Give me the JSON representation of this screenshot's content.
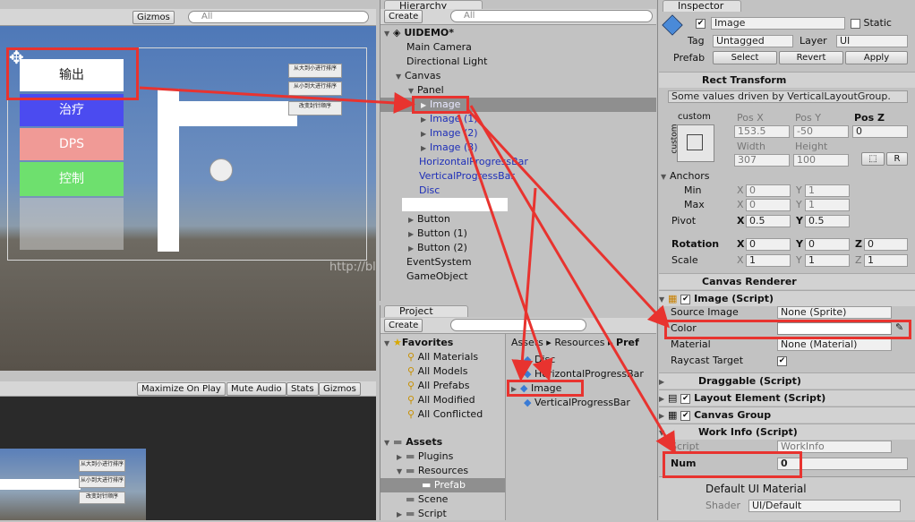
{
  "scene_toolbar": {
    "gizmos": "Gizmos",
    "search_placeholder": "All"
  },
  "scene": {
    "btn_output": "输出",
    "btn_heal": "治疗",
    "btn_dps": "DPS",
    "btn_control": "控制",
    "ctx1": "从大到小进行排序",
    "ctx2": "从小到大进行排序",
    "ctx3": "改变封针顺序",
    "watermark": "http://blog.csdn.net/"
  },
  "game_toolbar": {
    "maximize": "Maximize On Play",
    "mute": "Mute Audio",
    "stats": "Stats",
    "gizmos": "Gizmos"
  },
  "game": {
    "ctx1": "从大到小进行排序",
    "ctx2": "从小到大进行排序",
    "ctx3": "改变封针顺序"
  },
  "hierarchy": {
    "tab": "Hierarchy",
    "create": "Create",
    "search_placeholder": "All",
    "scene_name": "UIDEMO*",
    "items": [
      "Main Camera",
      "Directional Light",
      "Canvas",
      "Panel",
      "Image",
      "Image (1)",
      "Image (2)",
      "Image (3)",
      "HorizontalProgressBar",
      "VerticalProgressBar",
      "Disc",
      "Button",
      "Button (1)",
      "Button (2)",
      "EventSystem",
      "GameObject"
    ]
  },
  "project": {
    "tab": "Project",
    "create": "Create",
    "favorites": "Favorites",
    "fav_items": [
      "All Materials",
      "All Models",
      "All Prefabs",
      "All Modified",
      "All Conflicted"
    ],
    "assets": "Assets",
    "asset_items": [
      "Plugins",
      "Resources",
      "Prefab",
      "Scene",
      "Script"
    ],
    "breadcrumb": [
      "Assets",
      "Resources",
      "Pref"
    ],
    "files": [
      "Disc",
      "HorizontalProgressBar",
      "Image",
      "VerticalProgressBar"
    ]
  },
  "inspector": {
    "tab": "Inspector",
    "name": "Image",
    "static": "Static",
    "tag_label": "Tag",
    "tag": "Untagged",
    "layer_label": "Layer",
    "layer": "UI",
    "prefab_label": "Prefab",
    "select": "Select",
    "revert": "Revert",
    "apply": "Apply",
    "rect_transform": "Rect Transform",
    "driven_note": "Some values driven by VerticalLayoutGroup.",
    "anchor_preset": "custom",
    "anchor_side": "custom",
    "pos_x_label": "Pos X",
    "pos_y_label": "Pos Y",
    "pos_z_label": "Pos Z",
    "pos_x": "153.5",
    "pos_y": "-50",
    "pos_z": "0",
    "width_label": "Width",
    "height_label": "Height",
    "width": "307",
    "height": "100",
    "r_button": "R",
    "anchors": "Anchors",
    "min": "Min",
    "max": "Max",
    "pivot": "Pivot",
    "x": "X",
    "y": "Y",
    "z": "Z",
    "min_x": "0",
    "min_y": "1",
    "max_x": "0",
    "max_y": "1",
    "pivot_x": "0.5",
    "pivot_y": "0.5",
    "rotation": "Rotation",
    "rot_x": "0",
    "rot_y": "0",
    "rot_z": "0",
    "scale": "Scale",
    "scale_x": "1",
    "scale_y": "1",
    "scale_z": "1",
    "canvas_renderer": "Canvas Renderer",
    "image_script": "Image (Script)",
    "source_image": "Source Image",
    "source_image_val": "None (Sprite)",
    "color": "Color",
    "material": "Material",
    "material_val": "None (Material)",
    "raycast": "Raycast Target",
    "draggable": "Draggable (Script)",
    "layout_element": "Layout Element (Script)",
    "canvas_group": "Canvas Group",
    "work_info": "Work Info (Script)",
    "script": "Script",
    "script_val": "WorkInfo",
    "num": "Num",
    "num_val": "0",
    "default_material": "Default UI Material",
    "shader": "Shader",
    "shader_val": "UI/Default"
  }
}
